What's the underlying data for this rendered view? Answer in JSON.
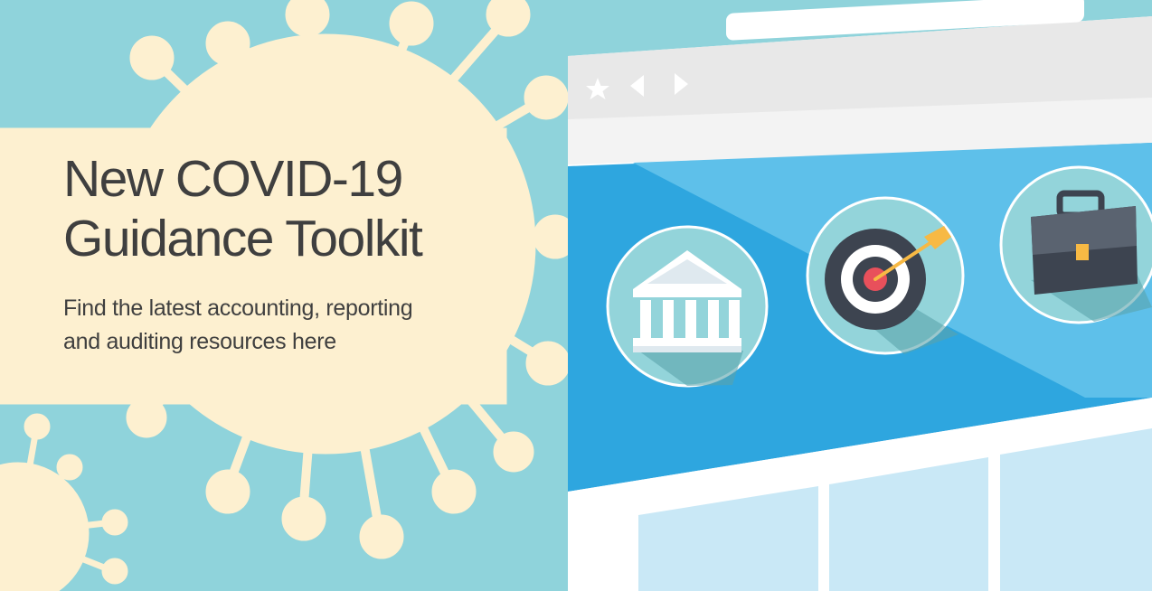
{
  "banner": {
    "headline_line1": "New COVID-19",
    "headline_line2": "Guidance Toolkit",
    "subline_line1": "Find the latest accounting, reporting",
    "subline_line2": "and auditing resources here"
  },
  "browser": {
    "nav_icons": [
      "star-icon",
      "back-arrow-icon",
      "forward-arrow-icon"
    ],
    "content_icons": [
      "bank-building-icon",
      "target-dart-icon",
      "briefcase-icon"
    ]
  },
  "colors": {
    "background": "#8fd3db",
    "virus": "#fdf0d0",
    "browser_blue": "#2ea6df",
    "browser_chrome": "#e9e9e9",
    "text": "#3f3f3f"
  }
}
